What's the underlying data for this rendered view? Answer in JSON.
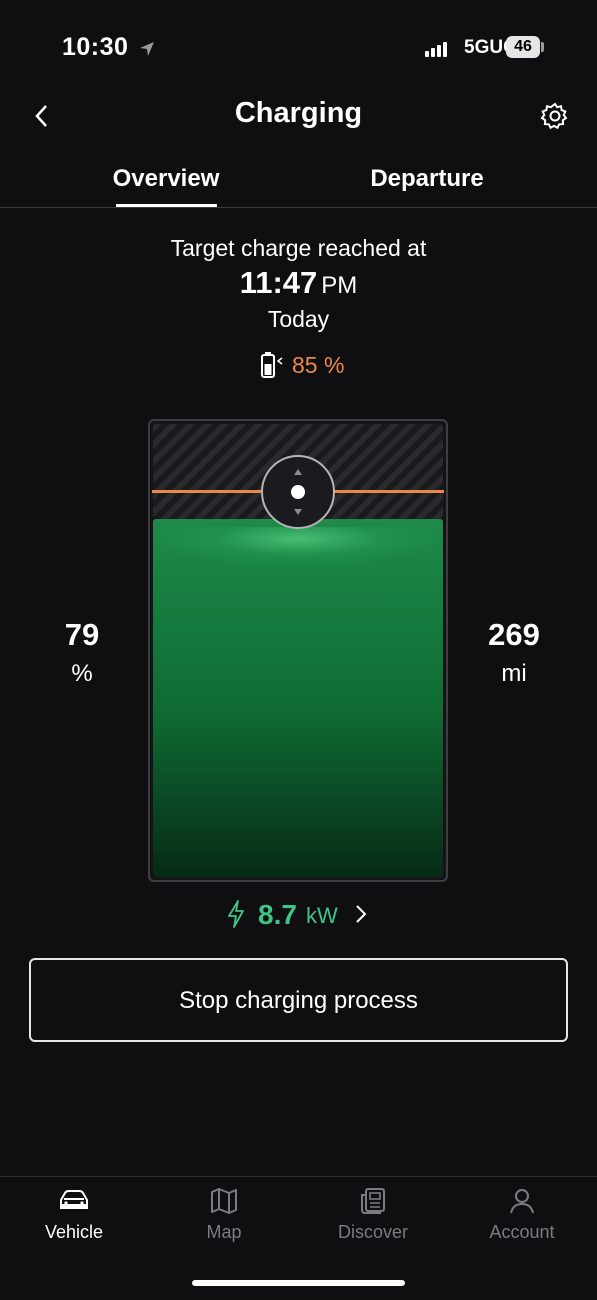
{
  "status_bar": {
    "time": "10:30",
    "network": "5GUC",
    "battery": "46"
  },
  "header": {
    "title": "Charging",
    "back_icon": "chevron-left-icon",
    "settings_icon": "gear-icon"
  },
  "tabs": [
    {
      "label": "Overview",
      "active": true
    },
    {
      "label": "Departure",
      "active": false
    }
  ],
  "target": {
    "label": "Target charge reached at",
    "time": "11:47",
    "ampm": "PM",
    "day": "Today",
    "limit_percent": "85 %"
  },
  "battery_visual": {
    "state_of_charge": "79",
    "soc_unit": "%",
    "range": "269",
    "range_unit": "mi",
    "fill_fraction": 0.79,
    "limit_fraction": 0.85,
    "colors": {
      "fill": "#1f8a4a",
      "limit": "#e8894a"
    }
  },
  "power": {
    "value": "8.7",
    "unit": "kW",
    "color": "#3fc486"
  },
  "actions": {
    "stop_label": "Stop charging process"
  },
  "bottom_nav": [
    {
      "label": "Vehicle",
      "icon": "car-icon",
      "active": true
    },
    {
      "label": "Map",
      "icon": "map-icon",
      "active": false
    },
    {
      "label": "Discover",
      "icon": "news-icon",
      "active": false
    },
    {
      "label": "Account",
      "icon": "person-icon",
      "active": false
    }
  ]
}
